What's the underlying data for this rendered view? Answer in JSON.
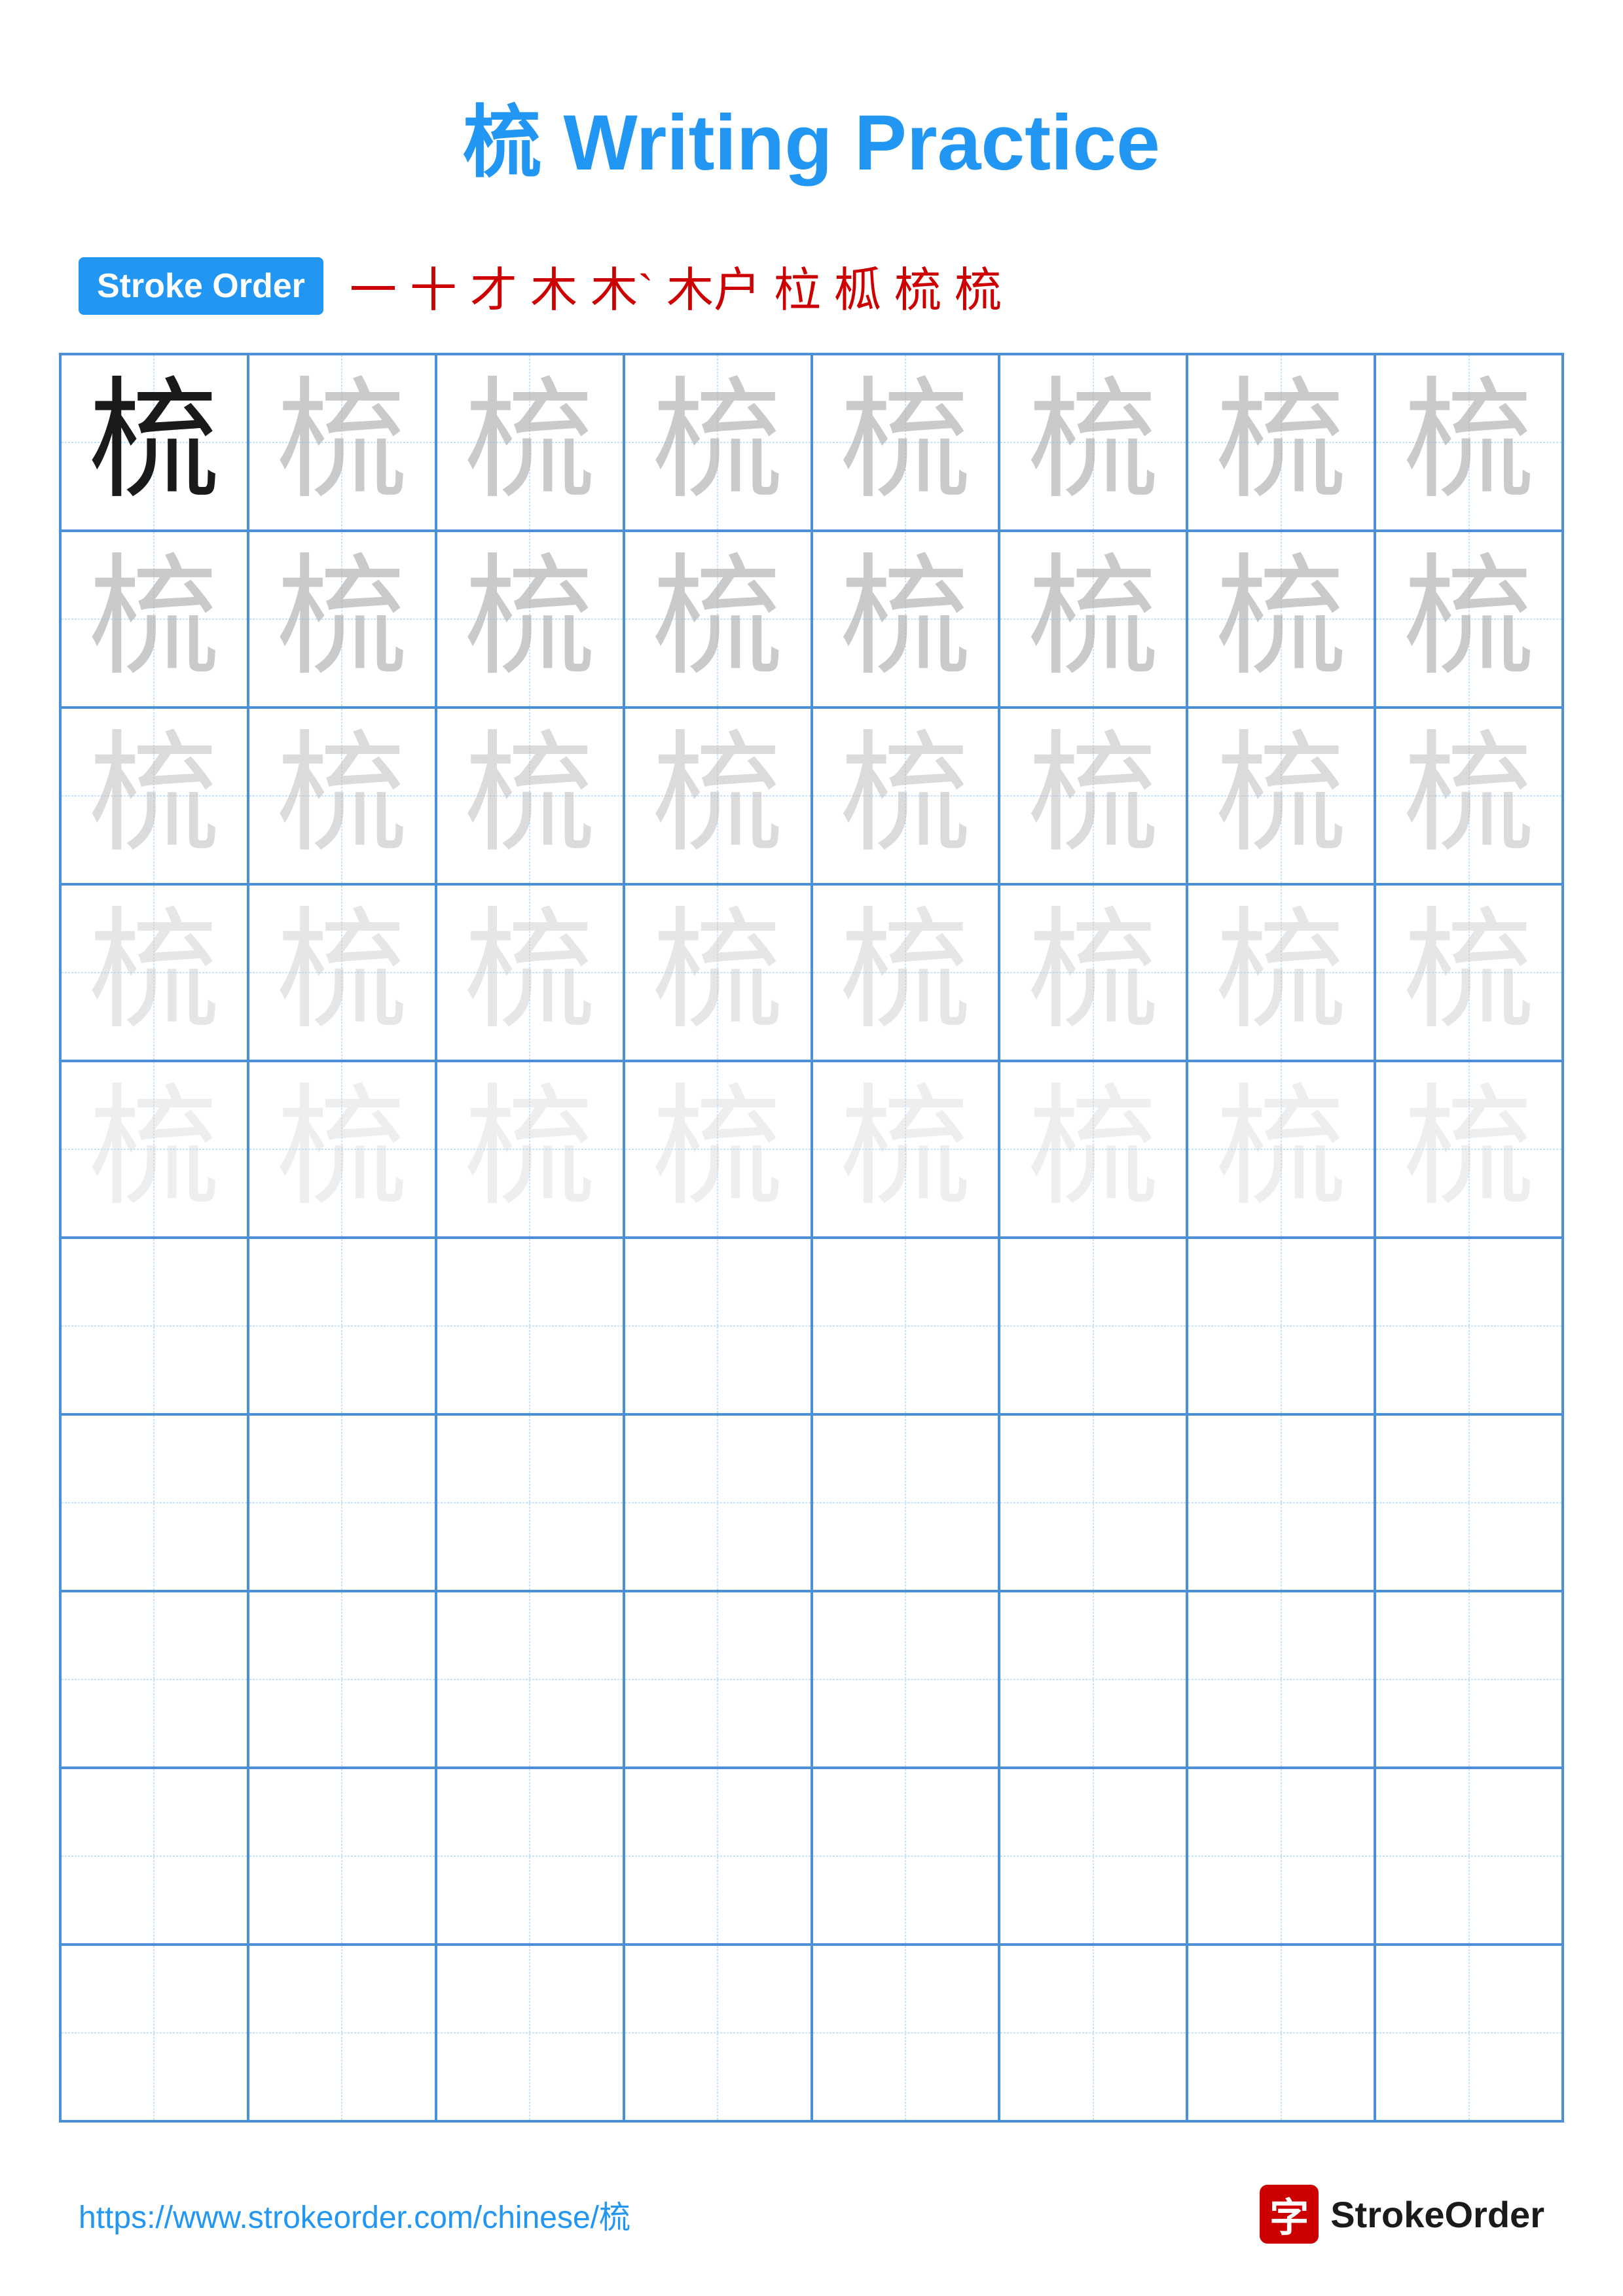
{
  "title": {
    "character": "梳",
    "label": "Writing Practice",
    "full": "梳 Writing Practice"
  },
  "stroke_order": {
    "badge_label": "Stroke Order",
    "strokes": [
      "一",
      "十",
      "才",
      "木",
      "木`",
      "木户",
      "柆",
      "柧",
      "梳",
      "梳"
    ]
  },
  "grid": {
    "rows": 10,
    "cols": 8,
    "character": "梳",
    "practice_rows": [
      {
        "type": "mixed",
        "cells": [
          "dark",
          "light1",
          "light1",
          "light1",
          "light1",
          "light1",
          "light1",
          "light1"
        ]
      },
      {
        "type": "light1",
        "cells": [
          "light1",
          "light1",
          "light1",
          "light1",
          "light1",
          "light1",
          "light1",
          "light1"
        ]
      },
      {
        "type": "light2",
        "cells": [
          "light2",
          "light2",
          "light2",
          "light2",
          "light2",
          "light2",
          "light2",
          "light2"
        ]
      },
      {
        "type": "light3",
        "cells": [
          "light3",
          "light3",
          "light3",
          "light3",
          "light3",
          "light3",
          "light3",
          "light3"
        ]
      },
      {
        "type": "light4",
        "cells": [
          "light4",
          "light4",
          "light4",
          "light4",
          "light4",
          "light4",
          "light4",
          "light4"
        ]
      },
      {
        "type": "empty",
        "cells": [
          "",
          "",
          "",
          "",
          "",
          "",
          "",
          ""
        ]
      },
      {
        "type": "empty",
        "cells": [
          "",
          "",
          "",
          "",
          "",
          "",
          "",
          ""
        ]
      },
      {
        "type": "empty",
        "cells": [
          "",
          "",
          "",
          "",
          "",
          "",
          "",
          ""
        ]
      },
      {
        "type": "empty",
        "cells": [
          "",
          "",
          "",
          "",
          "",
          "",
          "",
          ""
        ]
      },
      {
        "type": "empty",
        "cells": [
          "",
          "",
          "",
          "",
          "",
          "",
          "",
          ""
        ]
      }
    ]
  },
  "footer": {
    "url": "https://www.strokeorder.com/chinese/梳",
    "logo_char": "字",
    "logo_text": "StrokeOrder"
  },
  "colors": {
    "title_blue": "#2196F3",
    "stroke_red": "#cc0000",
    "grid_blue": "#4A90D9",
    "grid_dashed": "#90CAF9"
  }
}
